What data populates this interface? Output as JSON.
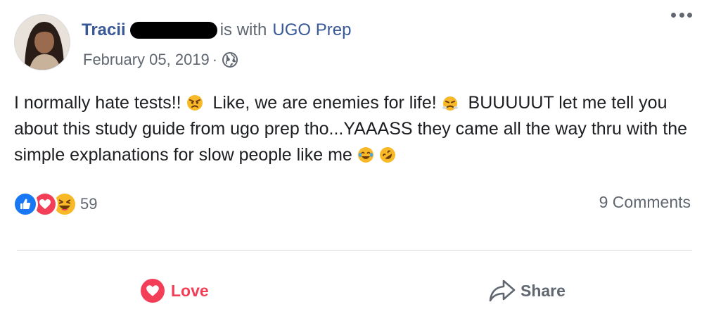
{
  "post": {
    "author_name": "Tracii",
    "with_text": "is with",
    "tagged_page": "UGO Prep",
    "date": "February 05, 2019",
    "date_separator": "·",
    "privacy_icon": "globe-icon",
    "body": {
      "part1": "I normally hate tests!!",
      "emoji1": "angry-face-emoji",
      "part2": "Like, we are enemies for life!",
      "emoji2": "face-with-steam-emoji",
      "part3": "BUUUUUT let me tell you about this study guide from ugo prep tho...YAAASS they came all the way thru with the simple explanations for slow people like me",
      "emoji3": "tears-of-joy-emoji",
      "emoji4": "rolling-on-floor-laughing-emoji"
    }
  },
  "reactions": {
    "icons": [
      "like-icon",
      "love-icon",
      "haha-icon"
    ],
    "count": "59"
  },
  "comments": {
    "label": "9 Comments"
  },
  "actions": {
    "love_label": "Love",
    "share_label": "Share"
  },
  "colors": {
    "link": "#385898",
    "secondary_text": "#606770",
    "love": "#f33e58",
    "like": "#1877f2",
    "haha": "#f7b928",
    "divider": "#dadde1"
  }
}
